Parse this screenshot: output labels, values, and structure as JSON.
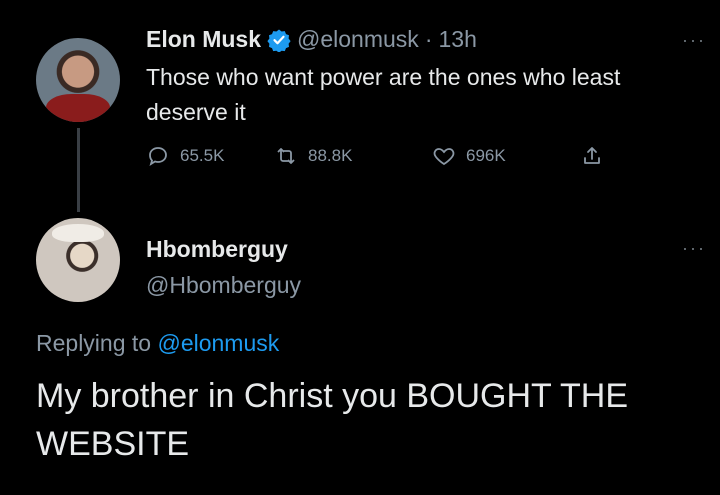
{
  "tweet": {
    "author_name": "Elon Musk",
    "author_handle": "@elonmusk",
    "separator": "·",
    "time": "13h",
    "text": "Those who want power are the ones who least deserve it",
    "stats": {
      "replies": "65.5K",
      "retweets": "88.8K",
      "likes": "696K"
    },
    "more_label": "···"
  },
  "reply": {
    "author_name": "Hbomberguy",
    "author_handle": "@Hbomberguy",
    "replying_prefix": "Replying to",
    "replying_handle": "@elonmusk",
    "text": "My brother in Christ you BOUGHT THE WEBSITE",
    "more_label": "···"
  },
  "colors": {
    "background": "#000000",
    "text_primary": "#e7e9ea",
    "text_secondary": "#8b98a5",
    "accent": "#1d9bf0"
  },
  "icons": [
    "verified-badge-icon",
    "reply-icon",
    "retweet-icon",
    "like-icon",
    "share-icon",
    "more-icon"
  ]
}
